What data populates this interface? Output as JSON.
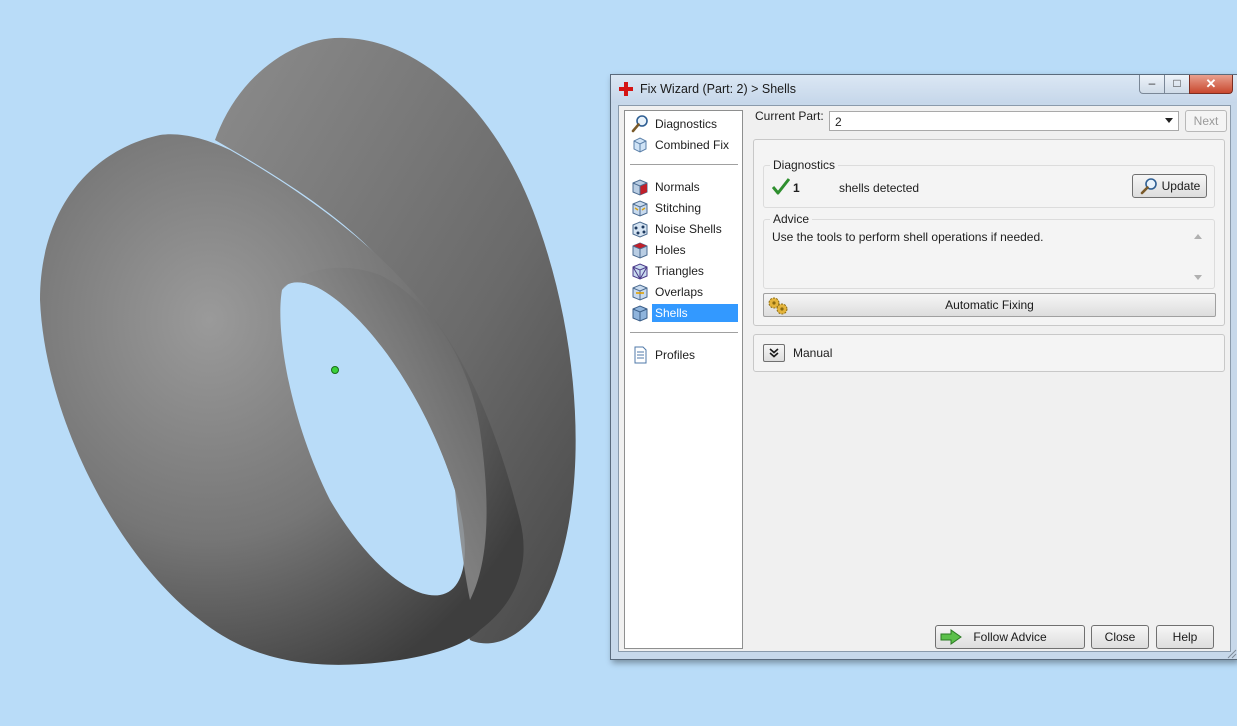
{
  "window": {
    "title": "Fix Wizard (Part: 2) > Shells",
    "minimize_glyph": "–",
    "maximize_glyph": "□",
    "close_glyph": "✕"
  },
  "nav": {
    "items": [
      {
        "label": "Diagnostics",
        "icon": "magnifier-icon"
      },
      {
        "label": "Combined Fix",
        "icon": "cube-icon"
      },
      {
        "label": "Normals",
        "icon": "normals-cube-icon"
      },
      {
        "label": "Stitching",
        "icon": "stitching-cube-icon"
      },
      {
        "label": "Noise Shells",
        "icon": "noise-shells-icon"
      },
      {
        "label": "Holes",
        "icon": "holes-cube-icon"
      },
      {
        "label": "Triangles",
        "icon": "triangles-cube-icon"
      },
      {
        "label": "Overlaps",
        "icon": "overlaps-cube-icon"
      },
      {
        "label": "Shells",
        "icon": "shells-cube-icon",
        "selected": true
      },
      {
        "label": "Profiles",
        "icon": "document-icon"
      }
    ]
  },
  "main": {
    "current_part_label": "Current Part:",
    "current_part_value": "2",
    "next_label": "Next",
    "diagnostics_title": "Diagnostics",
    "shell_count": "1",
    "shells_text": "shells detected",
    "update_label": "Update",
    "advice_title": "Advice",
    "advice_text": "Use the tools to perform shell operations if needed.",
    "automatic_fixing_label": "Automatic Fixing",
    "manual_label": "Manual"
  },
  "footer": {
    "follow_advice_label": "Follow Advice",
    "close_label": "Close",
    "help_label": "Help"
  },
  "colors": {
    "background": "#b9dcf8",
    "selection": "#3399ff",
    "check": "#2f8f2f",
    "model": "#6e6e6e"
  }
}
